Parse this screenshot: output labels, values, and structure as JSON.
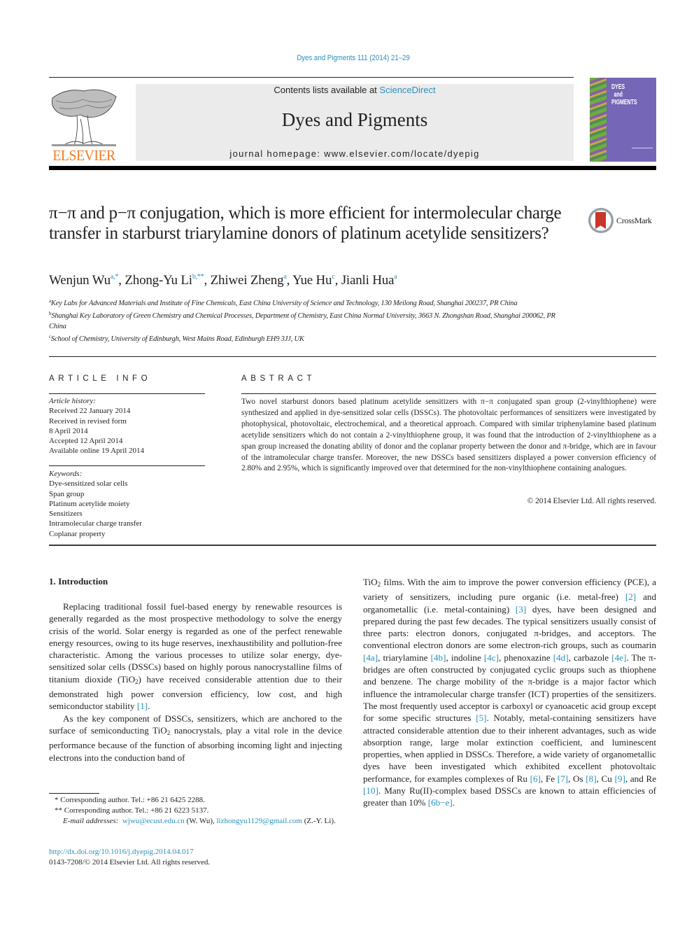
{
  "header": {
    "citation": "Dyes and Pigments 111 (2014) 21–29",
    "contents_prefix": "Contents lists available at ",
    "contents_link": "ScienceDirect",
    "journal_name": "Dyes and Pigments",
    "homepage": "journal homepage: www.elsevier.com/locate/dyepig",
    "publisher_logo": "ELSEVIER",
    "cover_title_lines": [
      "DYES",
      "and",
      "PIGMENTS"
    ],
    "colors": {
      "link": "#2a8fbd",
      "elsevier_orange": "#f47a20",
      "cover_purple": "#7566b8",
      "masthead_gray": "#ebebeb"
    }
  },
  "article": {
    "title": "π−π and p−π conjugation, which is more efficient for intermolecular charge transfer in starburst triarylamine donors of platinum acetylide sensitizers?",
    "crossmark_label": "CrossMark",
    "authors": [
      {
        "name": "Wenjun Wu",
        "sup": "a,*"
      },
      {
        "name": "Zhong-Yu Li",
        "sup": "b,**"
      },
      {
        "name": "Zhiwei Zheng",
        "sup": "a"
      },
      {
        "name": "Yue Hu",
        "sup": "c"
      },
      {
        "name": "Jianli Hua",
        "sup": "a"
      }
    ],
    "affiliations": [
      {
        "mark": "a",
        "text": "Key Labs for Advanced Materials and Institute of Fine Chemicals, East China University of Science and Technology, 130 Meilong Road, Shanghai 200237, PR China"
      },
      {
        "mark": "b",
        "text": "Shanghai Key Laboratory of Green Chemistry and Chemical Processes, Department of Chemistry, East China Normal University, 3663 N. Zhongshan Road, Shanghai 200062, PR China"
      },
      {
        "mark": "c",
        "text": "School of Chemistry, University of Edinburgh, West Mains Road, Edinburgh EH9 3JJ, UK"
      }
    ]
  },
  "article_info": {
    "heading": "ARTICLE INFO",
    "history_label": "Article history:",
    "history": [
      "Received 22 January 2014",
      "Received in revised form",
      "8 April 2014",
      "Accepted 12 April 2014",
      "Available online 19 April 2014"
    ],
    "keywords_label": "Keywords:",
    "keywords": [
      "Dye-sensitized solar cells",
      "Span group",
      "Platinum acetylide moiety",
      "Sensitizers",
      "Intramolecular charge transfer",
      "Coplanar property"
    ]
  },
  "abstract": {
    "heading": "ABSTRACT",
    "text": "Two novel starburst donors based platinum acetylide sensitizers with π−π conjugated span group (2-vinylthiophene) were synthesized and applied in dye-sensitized solar cells (DSSCs). The photovoltaic performances of sensitizers were investigated by photophysical, photovoltaic, electrochemical, and a theoretical approach. Compared with similar triphenylamine based platinum acetylide sensitizers which do not contain a 2-vinylthiophene group, it was found that the introduction of 2-vinylthiophene as a span group increased the donating ability of donor and the coplanar property between the donor and π-bridge, which are in favour of the intramolecular charge transfer. Moreover, the new DSSCs based sensitizers displayed a power conversion efficiency of 2.80% and 2.95%, which is significantly improved over that determined for the non-vinylthiophene containing analogues.",
    "copyright": "© 2014 Elsevier Ltd. All rights reserved."
  },
  "body": {
    "section_heading": "1.  Introduction",
    "left": {
      "p1": [
        "Replacing traditional fossil fuel-based energy by renewable resources is generally regarded as the most prospective methodology to solve the energy crisis of the world. Solar energy is regarded as one of the perfect renewable energy resources, owing to its huge reserves, inexhaustibility and pollution-free characteristic. Among the various processes to utilize solar energy, dye-sensitized solar cells (DSSCs) based on highly porous nanocrystalline films of titanium dioxide (TiO",
        "2",
        ") have received considerable attention due to their demonstrated high power conversion efficiency, low cost, and high semiconductor stability ",
        "[1]",
        "."
      ],
      "p2": [
        "As the key component of DSSCs, sensitizers, which are anchored to the surface of semiconducting TiO",
        "2",
        " nanocrystals, play a vital role in the device performance because of the function of absorbing incoming light and injecting electrons into the conduction band of"
      ]
    },
    "right": {
      "segments": [
        "TiO",
        "2",
        " films. With the aim to improve the power conversion efficiency (PCE), a variety of sensitizers, including pure organic (i.e. metal-free) ",
        "[2]",
        " and organometallic (i.e. metal-containing) ",
        "[3]",
        " dyes, have been designed and prepared during the past few decades. The typical sensitizers usually consist of three parts: electron donors, conjugated π-bridges, and acceptors. The conventional electron donors are some electron-rich groups, such as coumarin ",
        "[4a]",
        ", triarylamine ",
        "[4b]",
        ", indoline ",
        "[4c]",
        ", phenoxazine ",
        "[4d]",
        ", carbazole ",
        "[4e]",
        ". The π-bridges are often constructed by conjugated cyclic groups such as thiophene and benzene. The charge mobility of the π-bridge is a major factor which influence the intramolecular charge transfer (ICT) properties of the sensitizers. The most frequently used acceptor is carboxyl or cyanoacetic acid group except for some specific structures ",
        "[5]",
        ". Notably, metal-containing sensitizers have attracted considerable attention due to their inherent advantages, such as wide absorption range, large molar extinction coefficient, and luminescent properties, when applied in DSSCs. Therefore, a wide variety of organometallic dyes have been investigated which exhibited excellent photovoltaic performance, for examples complexes of Ru ",
        "[6]",
        ", Fe ",
        "[7]",
        ", Os ",
        "[8]",
        ", Cu ",
        "[9]",
        ", and Re ",
        "[10]",
        ". Many Ru(II)-complex based DSSCs are known to attain efficiencies of greater than 10% ",
        "[6b−e]",
        "."
      ]
    }
  },
  "footnotes": {
    "fn1": "*  Corresponding author. Tel.: +86 21 6425 2288.",
    "fn2": "**  Corresponding author. Tel.: +86 21 6223 5137.",
    "email_label": "E-mail addresses:",
    "email1": "wjwu@ecust.edu.cn",
    "email1_owner": " (W. Wu), ",
    "email2": "lizhongyu1129@gmail.com",
    "email2_owner": "(Z.-Y. Li).",
    "doi": "http://dx.doi.org/10.1016/j.dyepig.2014.04.017",
    "issn": "0143-7208/© 2014 Elsevier Ltd. All rights reserved."
  }
}
